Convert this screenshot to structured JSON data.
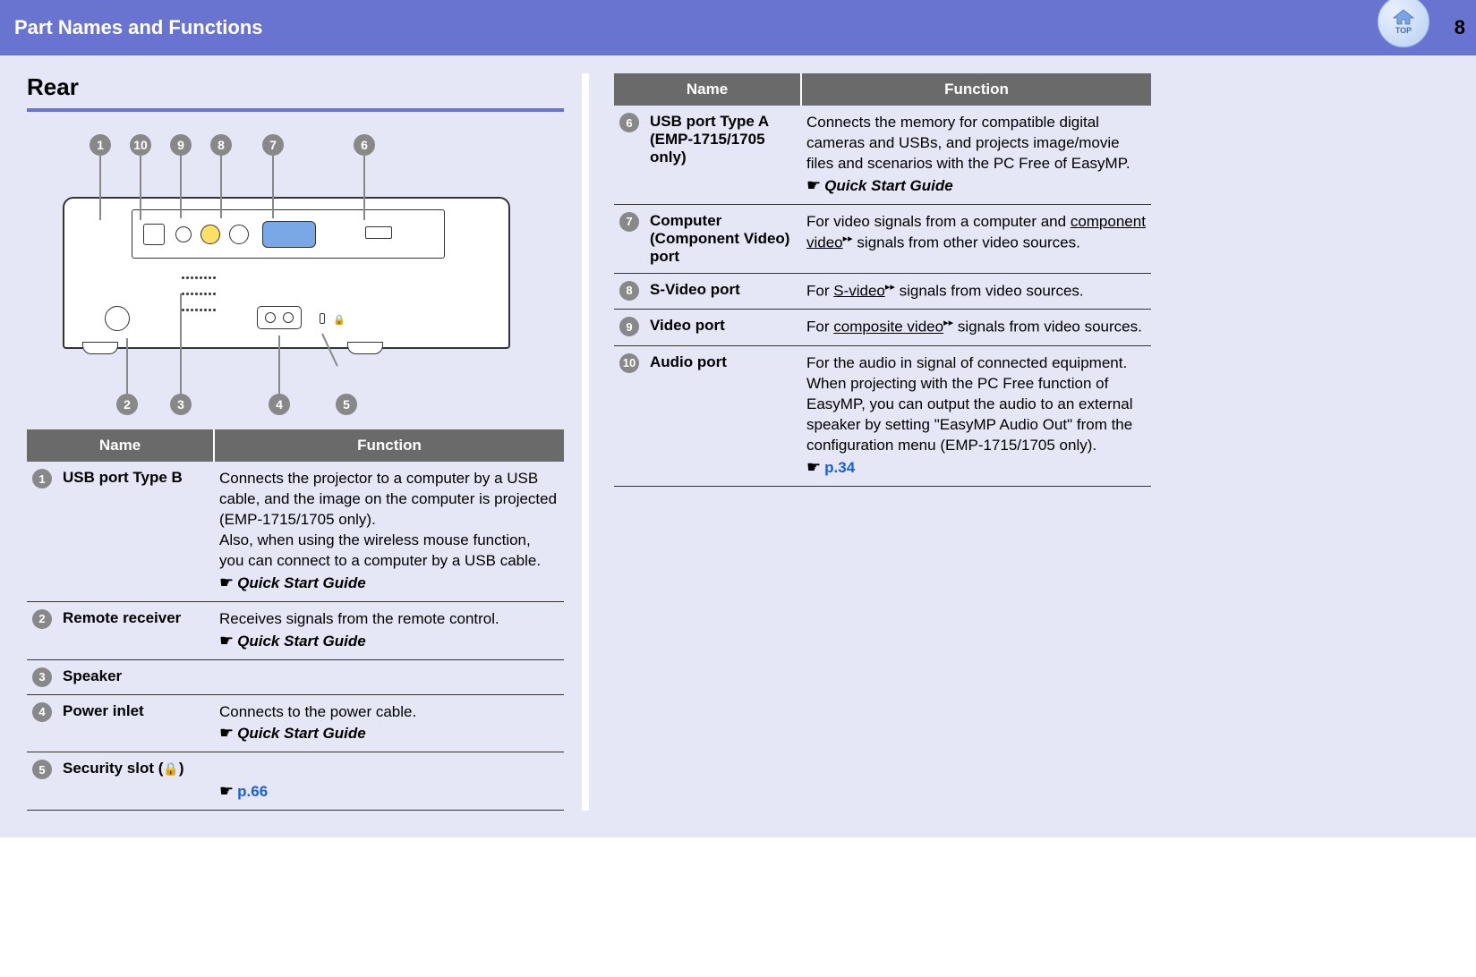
{
  "header": {
    "title": "Part Names and Functions",
    "page_number": "8",
    "top_label": "TOP"
  },
  "section": {
    "title": "Rear"
  },
  "table_headers": {
    "name": "Name",
    "function": "Function"
  },
  "refs": {
    "quick_start": "Quick Start Guide",
    "p66": "p.66",
    "p34": "p.34"
  },
  "callouts": {
    "n1": "1",
    "n2": "2",
    "n3": "3",
    "n4": "4",
    "n5": "5",
    "n6": "6",
    "n7": "7",
    "n8": "8",
    "n9": "9",
    "n10": "10"
  },
  "rows_left": [
    {
      "num": "1",
      "name": "USB port Type B",
      "function": "Connects the projector to a computer by a USB cable, and the image on the computer is projected (EMP-1715/1705 only).\nAlso, when using the wireless mouse function, you can connect to a computer by a USB cable.",
      "ref": "quick_start"
    },
    {
      "num": "2",
      "name": "Remote receiver",
      "function": "Receives signals from the remote control.",
      "ref": "quick_start"
    },
    {
      "num": "3",
      "name": "Speaker",
      "function": "",
      "ref": ""
    },
    {
      "num": "4",
      "name": "Power inlet",
      "function": "Connects to the power cable.",
      "ref": "quick_start"
    },
    {
      "num": "5",
      "name_prefix": "Security slot (",
      "name_suffix": ")",
      "function": "",
      "ref": "p66",
      "lock_icon": true
    }
  ],
  "rows_right": [
    {
      "num": "6",
      "name": "USB port Type A (EMP-1715/1705 only)",
      "function": "Connects the memory for compatible digital cameras and USBs, and projects image/movie files and scenarios with the PC Free of EasyMP.",
      "ref": "quick_start"
    },
    {
      "num": "7",
      "name": "Computer (Component Video) port",
      "function_parts": [
        "For video signals from a computer and ",
        {
          "glossary": "component video"
        },
        " signals from other video sources."
      ]
    },
    {
      "num": "8",
      "name": "S-Video port",
      "function_parts": [
        "For ",
        {
          "glossary": "S-video"
        },
        " signals from video sources."
      ]
    },
    {
      "num": "9",
      "name": "Video port",
      "function_parts": [
        "For ",
        {
          "glossary": "composite video"
        },
        " signals from video sources."
      ]
    },
    {
      "num": "10",
      "name": "Audio port",
      "function": "For the audio in signal of connected equipment.\nWhen projecting with the PC Free function of EasyMP, you can output the audio to an external speaker by setting \"EasyMP Audio Out\" from the configuration menu (EMP-1715/1705 only).",
      "ref": "p34"
    }
  ]
}
